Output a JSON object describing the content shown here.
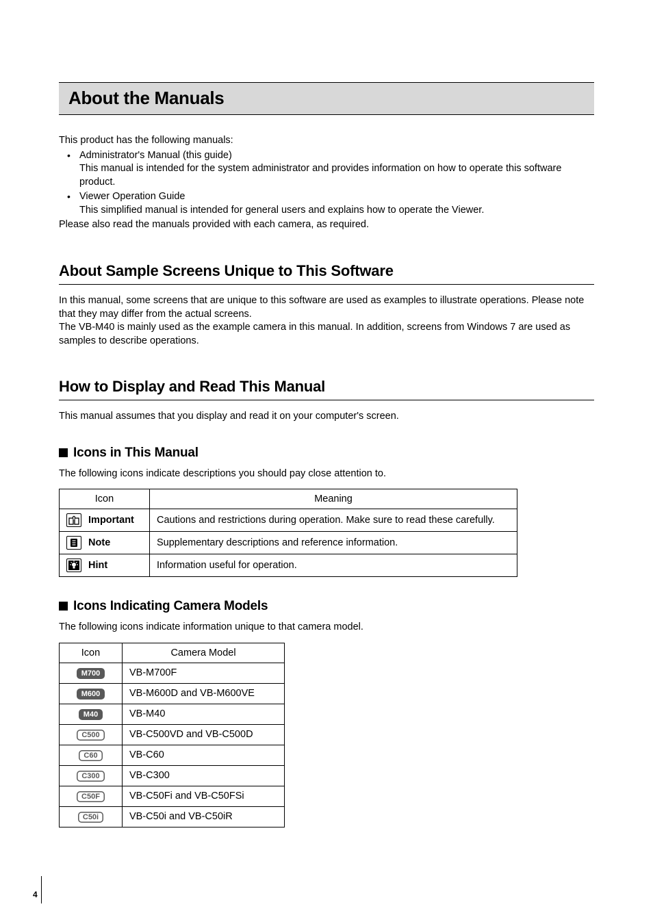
{
  "title": "About the Manuals",
  "intro": {
    "line1": "This product has the following manuals:",
    "items": [
      {
        "name": "Administrator's Manual (this guide)",
        "desc": "This manual is intended for the system administrator and provides information on how to operate this software product."
      },
      {
        "name": "Viewer Operation Guide",
        "desc": "This simplified manual is intended for general users and explains how to operate the Viewer."
      }
    ],
    "after": "Please also read the manuals provided with each camera, as required."
  },
  "section1": {
    "heading": "About Sample Screens Unique to This Software",
    "p1": "In this manual, some screens that are unique to this software are used as examples to illustrate operations. Please note that they may differ from the actual screens.",
    "p2": "The VB-M40 is mainly used as the example camera in this manual. In addition, screens from Windows 7 are used as samples to describe operations."
  },
  "section2": {
    "heading": "How to Display and Read This Manual",
    "p1": "This manual assumes that you display and read it on your computer's screen.",
    "sub1": {
      "heading": "Icons in This Manual",
      "lead": "The following icons indicate descriptions you should pay close attention to.",
      "th_icon": "Icon",
      "th_meaning": "Meaning",
      "rows": [
        {
          "label": "Important",
          "meaning": "Cautions and restrictions during operation. Make sure to read these carefully."
        },
        {
          "label": "Note",
          "meaning": "Supplementary descriptions and reference information."
        },
        {
          "label": "Hint",
          "meaning": "Information useful for operation."
        }
      ]
    },
    "sub2": {
      "heading": "Icons Indicating Camera Models",
      "lead": "The following icons indicate information unique to that camera model.",
      "th_icon": "Icon",
      "th_model": "Camera Model",
      "rows": [
        {
          "pill": "M700",
          "style": "dark",
          "model": "VB-M700F"
        },
        {
          "pill": "M600",
          "style": "dark",
          "model": "VB-M600D and VB-M600VE"
        },
        {
          "pill": "M40",
          "style": "dark",
          "model": "VB-M40"
        },
        {
          "pill": "C500",
          "style": "outline",
          "model": "VB-C500VD and VB-C500D"
        },
        {
          "pill": "C60",
          "style": "outline",
          "model": "VB-C60"
        },
        {
          "pill": "C300",
          "style": "outline",
          "model": "VB-C300"
        },
        {
          "pill": "C50F",
          "style": "outline",
          "model": "VB-C50Fi and VB-C50FSi"
        },
        {
          "pill": "C50i",
          "style": "outline",
          "model": "VB-C50i and VB-C50iR"
        }
      ]
    }
  },
  "page_number": "4"
}
